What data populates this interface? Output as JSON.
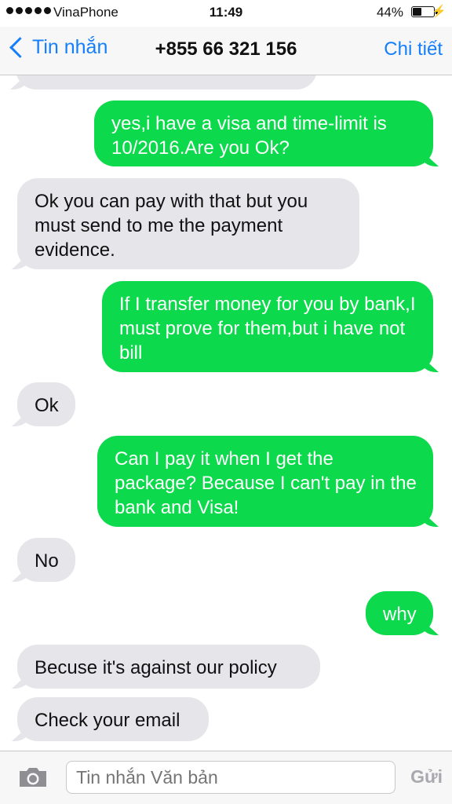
{
  "status_bar": {
    "carrier": "VinaPhone",
    "time": "11:49",
    "battery_percent_label": "44%",
    "battery_level": 0.44
  },
  "nav": {
    "back_label": "Tin nhắn",
    "title": "+855 66 321 156",
    "details_label": "Chi tiết"
  },
  "messages": [
    {
      "direction": "sent",
      "text": "yes,i have a visa and time-limit is 10/2016.Are you Ok?"
    },
    {
      "direction": "received",
      "text": "Ok you can pay with that but you must send to me the payment evidence."
    },
    {
      "direction": "sent",
      "text": "If I transfer money for you by bank,I must prove for them,but i have not bill"
    },
    {
      "direction": "received",
      "text": "Ok"
    },
    {
      "direction": "sent",
      "text": "Can I pay it when I get the package? Because I can't pay in the bank and Visa!"
    },
    {
      "direction": "received",
      "text": "No"
    },
    {
      "direction": "sent",
      "text": "why"
    },
    {
      "direction": "received",
      "text": "Becuse it's against our policy"
    },
    {
      "direction": "received",
      "text": "Check your email"
    }
  ],
  "composer": {
    "placeholder": "Tin nhắn Văn bản",
    "send_label": "Gửi",
    "camera_icon": "camera-icon"
  },
  "colors": {
    "sent_bubble": "#0cd94b",
    "received_bubble": "#e5e5ea",
    "accent": "#147efb"
  }
}
